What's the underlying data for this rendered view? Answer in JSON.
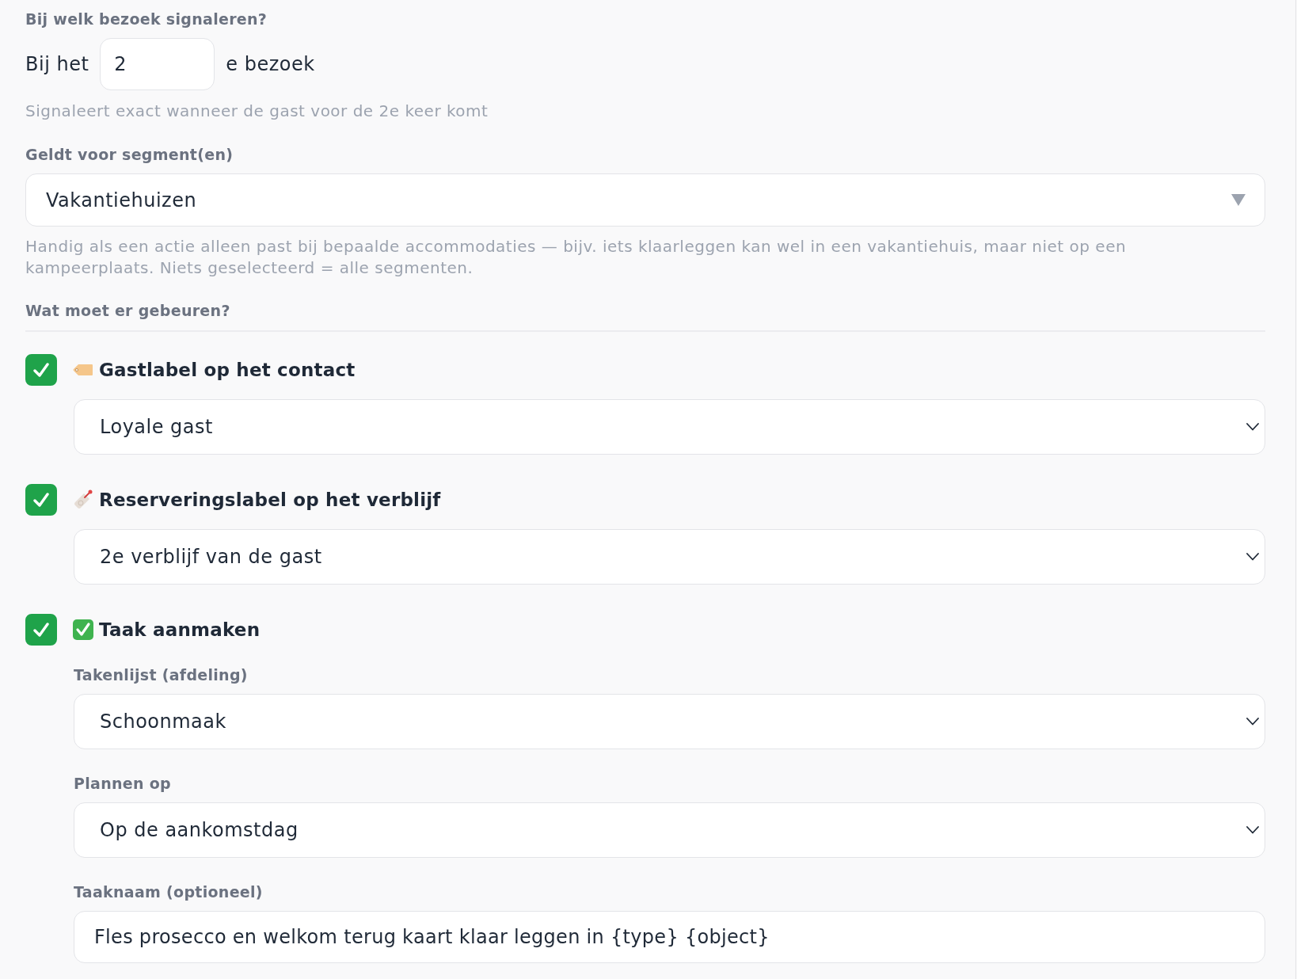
{
  "visit_trigger": {
    "label": "Bij welk bezoek signaleren?",
    "prefix": "Bij het",
    "value": "2",
    "suffix": "e bezoek",
    "hint": "Signaleert exact wanneer de gast voor de 2e keer komt"
  },
  "segment": {
    "label": "Geldt voor segment(en)",
    "value": "Vakantiehuizen",
    "help": "Handig als een actie alleen past bij bepaalde accommodaties — bijv. iets klaarleggen kan wel in een vakantiehuis, maar niet op een kampeerplaats. Niets geselecteerd = alle segmenten."
  },
  "actions_section": {
    "label": "Wat moet er gebeuren?"
  },
  "actions": [
    {
      "kind": "guestlabel",
      "checked": true,
      "title": "Gastlabel op het contact",
      "fields": [
        {
          "kind": "select",
          "value": "Loyale gast"
        }
      ]
    },
    {
      "kind": "bookinglabel",
      "checked": true,
      "title": "Reserveringslabel op het verblijf",
      "fields": [
        {
          "kind": "select",
          "value": "2e verblijf van de gast"
        }
      ]
    },
    {
      "kind": "task",
      "checked": true,
      "title": "Taak aanmaken",
      "fields": [
        {
          "kind": "select",
          "label": "Takenlijst (afdeling)",
          "value": "Schoonmaak"
        },
        {
          "kind": "select",
          "label": "Plannen op",
          "value": "Op de aankomstdag"
        },
        {
          "kind": "text",
          "label": "Taaknaam (optioneel)",
          "value": "Fles prosecco en welkom terug kaart klaar leggen in {type} {object}"
        }
      ]
    }
  ]
}
